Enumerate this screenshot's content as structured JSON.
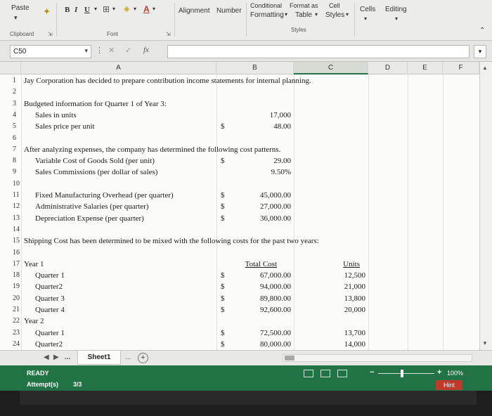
{
  "ribbon": {
    "paste": "Paste",
    "clipboard": "Clipboard",
    "font_buttons": [
      "B",
      "I",
      "U"
    ],
    "font": "Font",
    "alignment": "Alignment",
    "number": "Number",
    "conditional_formatting_line1": "Conditional",
    "conditional_formatting_line2": "Formatting",
    "format_as_table_line1": "Format as",
    "format_as_table_line2": "Table",
    "cell_styles_line1": "Cell",
    "cell_styles_line2": "Styles",
    "styles": "Styles",
    "cells": "Cells",
    "editing": "Editing"
  },
  "formula_bar": {
    "name_box": "C50",
    "cancel_symbol": "✕",
    "enter_symbol": "✓",
    "fx_symbol": "fx",
    "value": ""
  },
  "columns": [
    "A",
    "B",
    "C",
    "D",
    "E",
    "F"
  ],
  "rows": [
    {
      "n": "1",
      "a": "Jay Corporation  has decided to prepare contribution income statements for internal planning."
    },
    {
      "n": "2"
    },
    {
      "n": "3",
      "a": "Budgeted information for Quarter 1 of Year 3:"
    },
    {
      "n": "4",
      "a": "Sales in units",
      "c": "17,000"
    },
    {
      "n": "5",
      "a": "Sales price per unit",
      "b": "$",
      "c": "48.00"
    },
    {
      "n": "6"
    },
    {
      "n": "7",
      "a": "After analyzing expenses, the company has determined the following cost patterns."
    },
    {
      "n": "8",
      "a": "Variable Cost of Goods Sold (per unit)",
      "b": "$",
      "c": "29.00"
    },
    {
      "n": "9",
      "a": "Sales Commissions (per dollar of sales)",
      "c": "9.50%"
    },
    {
      "n": "10"
    },
    {
      "n": "11",
      "a": "Fixed Manufacturing Overhead (per quarter)",
      "b": "$",
      "c": "45,000.00"
    },
    {
      "n": "12",
      "a": "Administrative Salaries (per quarter)",
      "b": "$",
      "c": "27,000.00"
    },
    {
      "n": "13",
      "a": "Depreciation Expense (per quarter)",
      "b": "$",
      "c": "36,000.00"
    },
    {
      "n": "14"
    },
    {
      "n": "15",
      "a": "Shipping Cost has been determined to be mixed with the following costs for the past two years:"
    },
    {
      "n": "16"
    },
    {
      "n": "17",
      "a": "Year 1",
      "c": "Total Cost",
      "d": "Units"
    },
    {
      "n": "18",
      "a": "Quarter 1",
      "b": "$",
      "c": "67,000.00",
      "d": "12,500"
    },
    {
      "n": "19",
      "a": "Quarter2",
      "b": "$",
      "c": "94,000.00",
      "d": "21,000"
    },
    {
      "n": "20",
      "a": "Quarter 3",
      "b": "$",
      "c": "89,800.00",
      "d": "13,800"
    },
    {
      "n": "21",
      "a": "Quarter 4",
      "b": "$",
      "c": "92,600.00",
      "d": "20,000"
    },
    {
      "n": "22",
      "a": "Year 2"
    },
    {
      "n": "23",
      "a": "Quarter 1",
      "b": "$",
      "c": "72,500.00",
      "d": "13,700"
    },
    {
      "n": "24",
      "a": "Quarter2",
      "b": "$",
      "c": "80,000.00",
      "d": "14,000"
    }
  ],
  "sheet_tabs": {
    "prev": "◀",
    "next": "▶",
    "ellipsis": "...",
    "active": "Sheet1",
    "ellipsis_after": "...",
    "add": "+"
  },
  "status": {
    "mode": "READY",
    "attempts_label": "Attempt(s)",
    "attempts_value": "3/3",
    "zoom_minus": "−",
    "zoom_plus": "+",
    "zoom": "100%",
    "hint": "Hint"
  }
}
